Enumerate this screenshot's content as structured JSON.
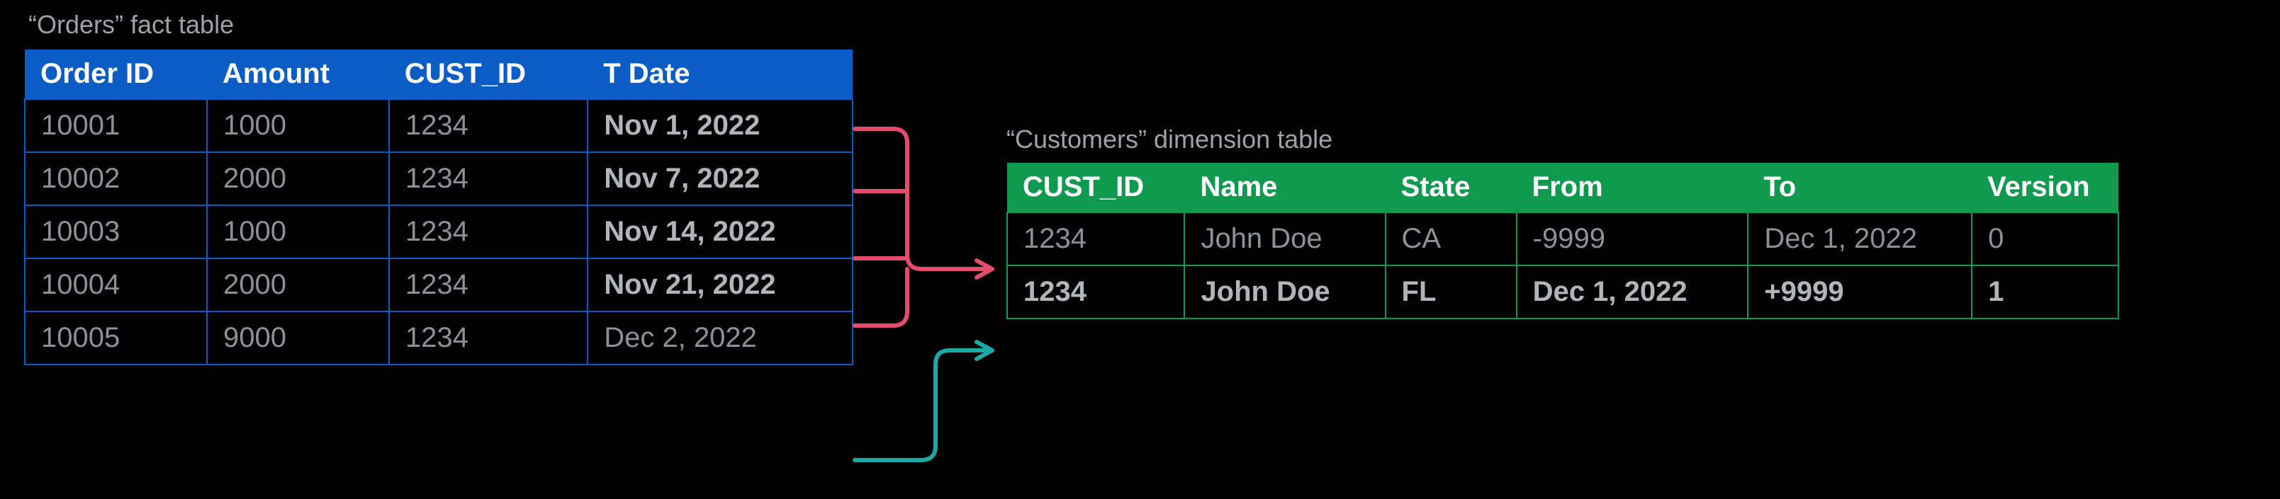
{
  "orders": {
    "caption": "“Orders” fact table",
    "headers": [
      "Order ID",
      "Amount",
      "CUST_ID",
      "T Date"
    ],
    "rows": [
      {
        "cells": [
          "10001",
          "1000",
          "1234",
          "Nov 1, 2022"
        ],
        "bold_date": true
      },
      {
        "cells": [
          "10002",
          "2000",
          "1234",
          "Nov 7, 2022"
        ],
        "bold_date": true
      },
      {
        "cells": [
          "10003",
          "1000",
          "1234",
          "Nov 14, 2022"
        ],
        "bold_date": true
      },
      {
        "cells": [
          "10004",
          "2000",
          "1234",
          "Nov 21, 2022"
        ],
        "bold_date": true
      },
      {
        "cells": [
          "10005",
          "9000",
          "1234",
          "Dec 2, 2022"
        ],
        "bold_date": false
      }
    ]
  },
  "customers": {
    "caption": "“Customers” dimension table",
    "headers": [
      "CUST_ID",
      "Name",
      "State",
      "From",
      "To",
      "Version"
    ],
    "rows": [
      {
        "cells": [
          "1234",
          "John Doe",
          "CA",
          "-9999",
          "Dec 1, 2022",
          "0"
        ],
        "highlight": false
      },
      {
        "cells": [
          "1234",
          "John Doe",
          "FL",
          "Dec 1, 2022",
          "+9999",
          "1"
        ],
        "highlight": true
      }
    ]
  },
  "connectors": {
    "red": {
      "color": "#e44b6c"
    },
    "teal": {
      "color": "#1aa9a3"
    }
  }
}
